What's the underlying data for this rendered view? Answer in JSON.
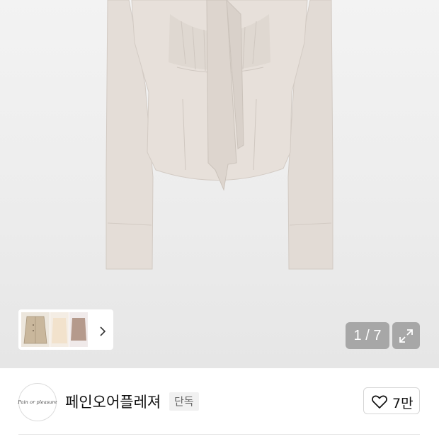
{
  "gallery": {
    "counter": "1 / 7",
    "current": 1,
    "total": 7,
    "thumb_next_icon": "chevron-right-icon",
    "expand_icon": "expand-icon"
  },
  "brand": {
    "logo_text": "Pain or pleasure",
    "name": "페인오어플레져",
    "badge": "단독",
    "like_icon": "heart-icon",
    "like_count": "7만"
  },
  "colors": {
    "garment": "#e4ddd7",
    "hero_bg": "#ededed",
    "overlay": "#808080",
    "badge_bg": "#f1f1f1"
  }
}
